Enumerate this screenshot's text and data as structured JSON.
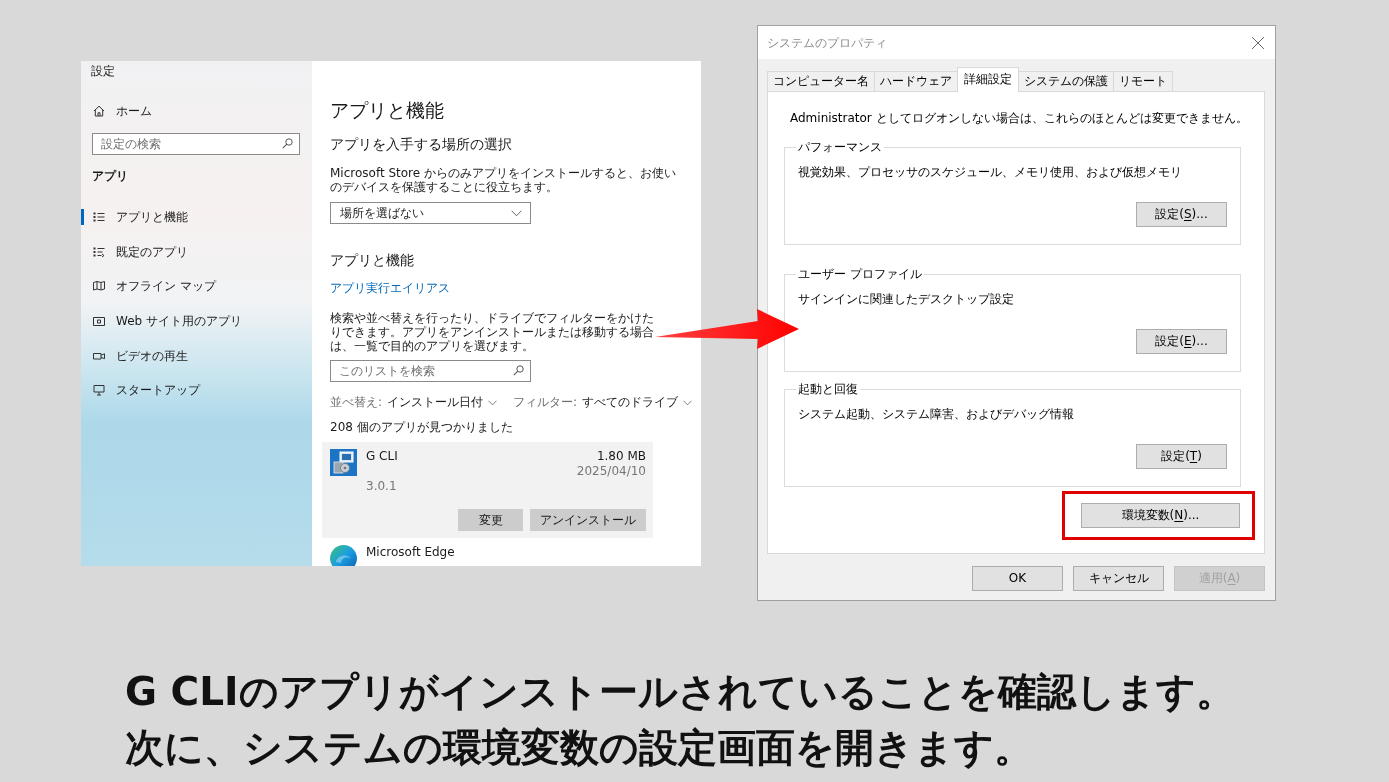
{
  "settings": {
    "title": "設定",
    "home": "ホーム",
    "search": {
      "placeholder": "設定の検索"
    },
    "section": "アプリ",
    "nav": [
      {
        "label": "アプリと機能",
        "selected": true
      },
      {
        "label": "既定のアプリ",
        "selected": false
      },
      {
        "label": "オフライン マップ",
        "selected": false
      },
      {
        "label": "Web サイト用のアプリ",
        "selected": false
      },
      {
        "label": "ビデオの再生",
        "selected": false
      },
      {
        "label": "スタートアップ",
        "selected": false
      }
    ]
  },
  "apps_page": {
    "title": "アプリと機能",
    "source_heading": "アプリを入手する場所の選択",
    "source_note": "Microsoft Store からのみアプリをインストールすると、お使いのデバイスを保護することに役立ちます。",
    "source_dropdown": {
      "value": "場所を選ばない"
    },
    "list_heading": "アプリと機能",
    "alias_link": "アプリ実行エイリアス",
    "list_note": "検索や並べ替えを行ったり、ドライブでフィルターをかけたりできます。アプリをアンインストールまたは移動する場合は、一覧で目的のアプリを選びます。",
    "list_search": {
      "placeholder": "このリストを検索"
    },
    "sort": {
      "label": "並べ替え:",
      "value": "インストール日付"
    },
    "filter": {
      "label": "フィルター:",
      "value": "すべてのドライブ"
    },
    "count": "208 個のアプリが見つかりました",
    "apps": [
      {
        "name": "G CLI",
        "size": "1.80 MB",
        "date": "2025/04/10",
        "version": "3.0.1",
        "selected": true,
        "buttons": [
          "変更",
          "アンインストール"
        ]
      },
      {
        "name": "Microsoft Edge",
        "selected": false
      }
    ]
  },
  "dialog": {
    "title": "システムのプロパティ",
    "tabs": [
      {
        "label": "コンピューター名",
        "selected": false
      },
      {
        "label": "ハードウェア",
        "selected": false
      },
      {
        "label": "詳細設定",
        "selected": true
      },
      {
        "label": "システムの保護",
        "selected": false
      },
      {
        "label": "リモート",
        "selected": false
      }
    ],
    "notice": "Administrator としてログオンしない場合は、これらのほとんどは変更できません。",
    "groups": [
      {
        "title": "パフォーマンス",
        "text": "視覚効果、プロセッサのスケジュール、メモリ使用、および仮想メモリ",
        "button": {
          "label": "設定(S)...",
          "mnemonic": true
        }
      },
      {
        "title": "ユーザー プロファイル",
        "text": "サインインに関連したデスクトップ設定",
        "button": {
          "label": "設定(E)...",
          "mnemonic": true
        }
      },
      {
        "title": "起動と回復",
        "text": "システム起動、システム障害、およびデバッグ情報",
        "button": {
          "label": "設定(T)",
          "mnemonic": true
        }
      }
    ],
    "env_button": {
      "label": "環境変数(N)...",
      "mnemonic": true,
      "highlighted": true
    },
    "footer_buttons": [
      {
        "label": "OK",
        "disabled": false
      },
      {
        "label": "キャンセル",
        "disabled": false
      },
      {
        "label": "適用(A)",
        "mnemonic": true,
        "disabled": true
      }
    ]
  },
  "caption": [
    "G CLIのアプリがインストールされていることを確認します。",
    "次に、システムの環境変数の設定画面を開きます。"
  ]
}
